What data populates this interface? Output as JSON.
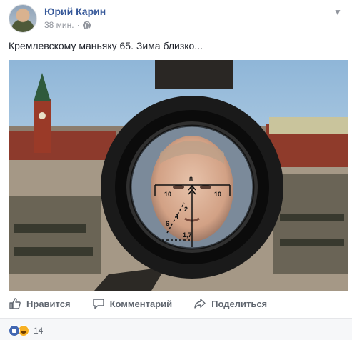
{
  "post": {
    "author": "Юрий Карин",
    "time": "38 мин.",
    "separator": "·",
    "text": "Кремлевскому маньяку 65. Зима близко..."
  },
  "image": {
    "scope_marks": {
      "top_left": "10",
      "top_right": "10",
      "top_mid": "8",
      "d2": "2",
      "d4": "4",
      "d6": "6",
      "d17": "1,7"
    }
  },
  "actions": {
    "like": "Нравится",
    "comment": "Комментарий",
    "share": "Поделиться"
  },
  "reactions": {
    "count": "14"
  },
  "colors": {
    "author_link": "#365899",
    "meta": "#90949c",
    "action": "#616770"
  }
}
